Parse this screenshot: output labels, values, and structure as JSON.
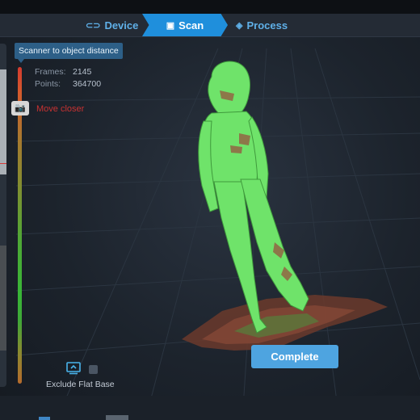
{
  "tabs": {
    "device": {
      "label": "Device",
      "icon": "link-icon"
    },
    "scan": {
      "label": "Scan",
      "icon": "scan-frame-icon",
      "active": true
    },
    "process": {
      "label": "Process",
      "icon": "layers-icon"
    }
  },
  "scanner": {
    "distance_tooltip": "Scanner to object distance",
    "frames_label": "Frames:",
    "frames_value": "2145",
    "points_label": "Points:",
    "points_value": "364700",
    "hint": "Move closer",
    "gauge_icon": "camera-icon"
  },
  "exclude_flat_base": {
    "label": "Exclude Flat Base",
    "checked": false,
    "icon": "flat-base-icon"
  },
  "complete_button": {
    "label": "Complete"
  },
  "colors": {
    "accent": "#1f8fdc",
    "button": "#4ea4e0",
    "mesh": "#6fe36a",
    "warning": "#c83232"
  }
}
